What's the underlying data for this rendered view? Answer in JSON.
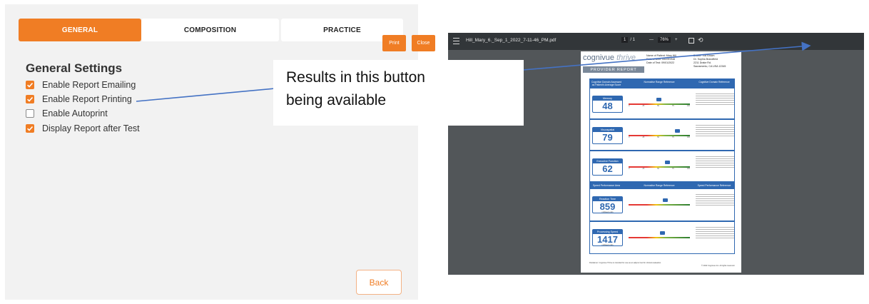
{
  "settings": {
    "tabs": [
      {
        "label": "GENERAL",
        "active": true
      },
      {
        "label": "COMPOSITION",
        "active": false
      },
      {
        "label": "PRACTICE",
        "active": false
      }
    ],
    "heading": "General Settings",
    "options": [
      {
        "label": "Enable Report Emailing",
        "checked": true
      },
      {
        "label": "Enable Report Printing",
        "checked": true
      },
      {
        "label": "Enable Autoprint",
        "checked": false
      },
      {
        "label": "Display Report after Test",
        "checked": true
      }
    ],
    "back_label": "Back",
    "accent_color": "#f07d24"
  },
  "callout": {
    "line1": "Results in this button",
    "line2": "being available"
  },
  "pdf_viewer": {
    "filename": "Hill_Mary_6._Sep_1_2022_7-11-46_PM.pdf",
    "page_current": "1",
    "page_total": "/ 1",
    "zoom_minus": "—",
    "zoom": "76%",
    "zoom_plus": "+",
    "print_label": "Print",
    "close_label": "Close",
    "toolbar_icons": [
      "menu-icon",
      "fit-page-icon",
      "rotate-icon"
    ]
  },
  "report": {
    "logo_text": "cognivue",
    "logo_script": "thrive",
    "banner": "PROVIDER REPORT",
    "info_left": [
      "Name of Patient: Mary Hill",
      "Date of Birth: 05/23/1948",
      "Date of Test: 09/01/2022"
    ],
    "info_right": [
      "Doctor: Tod Brown",
      "Dr. Sophia Brandfield",
      "2211 Drake Rd.",
      "Sacramento, CA USA 12345"
    ],
    "head1": [
      "Cognitive Domain Assessed as Patient's Average Score",
      "Normative Range Reference",
      "Cognitive Domain Reference"
    ],
    "domains": [
      {
        "name": "Memory",
        "score": "48",
        "marker": "48"
      },
      {
        "name": "Visuospatial",
        "score": "79",
        "marker": "79"
      },
      {
        "name": "Executive Function",
        "score": "62",
        "marker": "62"
      }
    ],
    "head2": [
      "Speed Performance Area",
      "Normative Range Reference",
      "Speed Performance Reference"
    ],
    "speeds": [
      {
        "name": "Reaction Time",
        "score": "859",
        "unit": "milliseconds",
        "marker": "859"
      },
      {
        "name": "Processing Speed",
        "score": "1417",
        "unit": "milliseconds",
        "marker": "1417"
      }
    ],
    "gauge_ticks": [
      "0",
      "25",
      "50",
      "75",
      "100"
    ],
    "footer": "Disclaimer: Cognivue Thrive is intended for use as an adjunct tool for clinical evaluation.",
    "copyright": "© 2022 Cognivue Inc. All rights reserved."
  }
}
